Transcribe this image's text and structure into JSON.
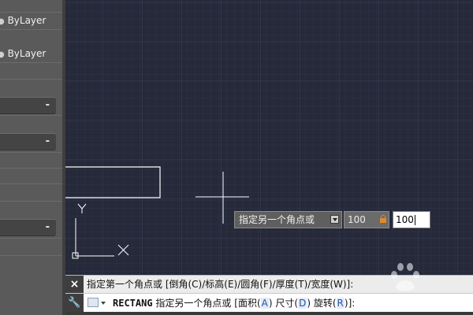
{
  "properties_panel": {
    "linetype_value": "ByLayer",
    "lineweight_value": "ByLayer",
    "collapse_symbol": "-"
  },
  "drawing": {
    "ucs_y_label": "Y",
    "ucs_x_label": "X"
  },
  "dynamic_input": {
    "prompt": "指定另一个角点或",
    "locked_value": "100",
    "active_value": "100"
  },
  "command_line": {
    "close_symbol": "×",
    "history_text": "指定第一个角点或 [倒角(C)/标高(E)/圆角(F)/厚度(T)/宽度(W)]:",
    "command_name": "RECTANG",
    "prompt": "指定另一个角点或",
    "options": [
      {
        "label": "面积",
        "key": "A"
      },
      {
        "label": "尺寸",
        "key": "D"
      },
      {
        "label": "旋转",
        "key": "R"
      }
    ],
    "tail": "]:"
  },
  "colors": {
    "canvas_background": "#25293a",
    "grid_minor": "#2e3344",
    "grid_major": "#3a4053",
    "lock_icon": "#e08a2a"
  },
  "icons": {
    "close": "close-icon",
    "wrench": "wrench-icon",
    "lock": "lock-icon",
    "dropdown": "dropdown-arrow-icon",
    "crosshair": "crosshair-cursor-icon"
  }
}
